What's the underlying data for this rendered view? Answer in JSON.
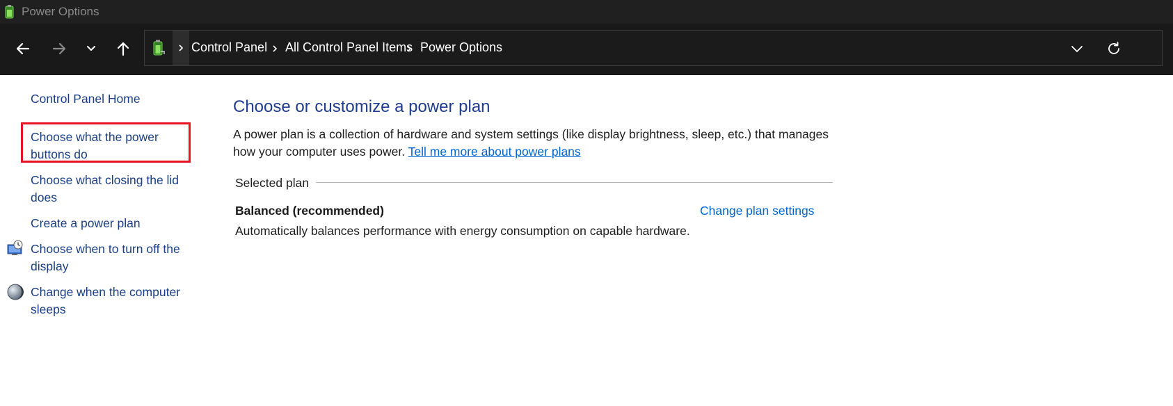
{
  "window": {
    "title": "Power Options"
  },
  "nav": {
    "back_icon": "arrow-left-icon",
    "forward_icon": "arrow-right-icon",
    "recent_icon": "chevron-down-icon",
    "up_icon": "arrow-up-icon"
  },
  "address": {
    "location_icon": "battery-plug-icon",
    "separator": "›",
    "crumbs": [
      "Control Panel",
      "All Control Panel Items",
      "Power Options"
    ],
    "dropdown_icon": "chevron-down-icon",
    "refresh_icon": "refresh-icon"
  },
  "sidebar": {
    "home": "Control Panel Home",
    "items": [
      {
        "label": "Choose what the power buttons do",
        "icon": ""
      },
      {
        "label": "Choose what closing the lid does",
        "icon": ""
      },
      {
        "label": "Create a power plan",
        "icon": ""
      },
      {
        "label": "Choose when to turn off the display",
        "icon": "monitor-clock-icon"
      },
      {
        "label": "Change when the computer sleeps",
        "icon": "moon-icon"
      }
    ]
  },
  "main": {
    "heading": "Choose or customize a power plan",
    "description": "A power plan is a collection of hardware and system settings (like display brightness, sleep, etc.) that manages how your computer uses power.",
    "learn_more": "Tell me more about power plans",
    "selected_plan_label": "Selected plan",
    "plan": {
      "name": "Balanced (recommended)",
      "change_link": "Change plan settings",
      "description": "Automatically balances performance with energy consumption on capable hardware."
    }
  },
  "colors": {
    "highlight": "#e81123",
    "link": "#0066cc",
    "heading": "#1f3c8e"
  }
}
